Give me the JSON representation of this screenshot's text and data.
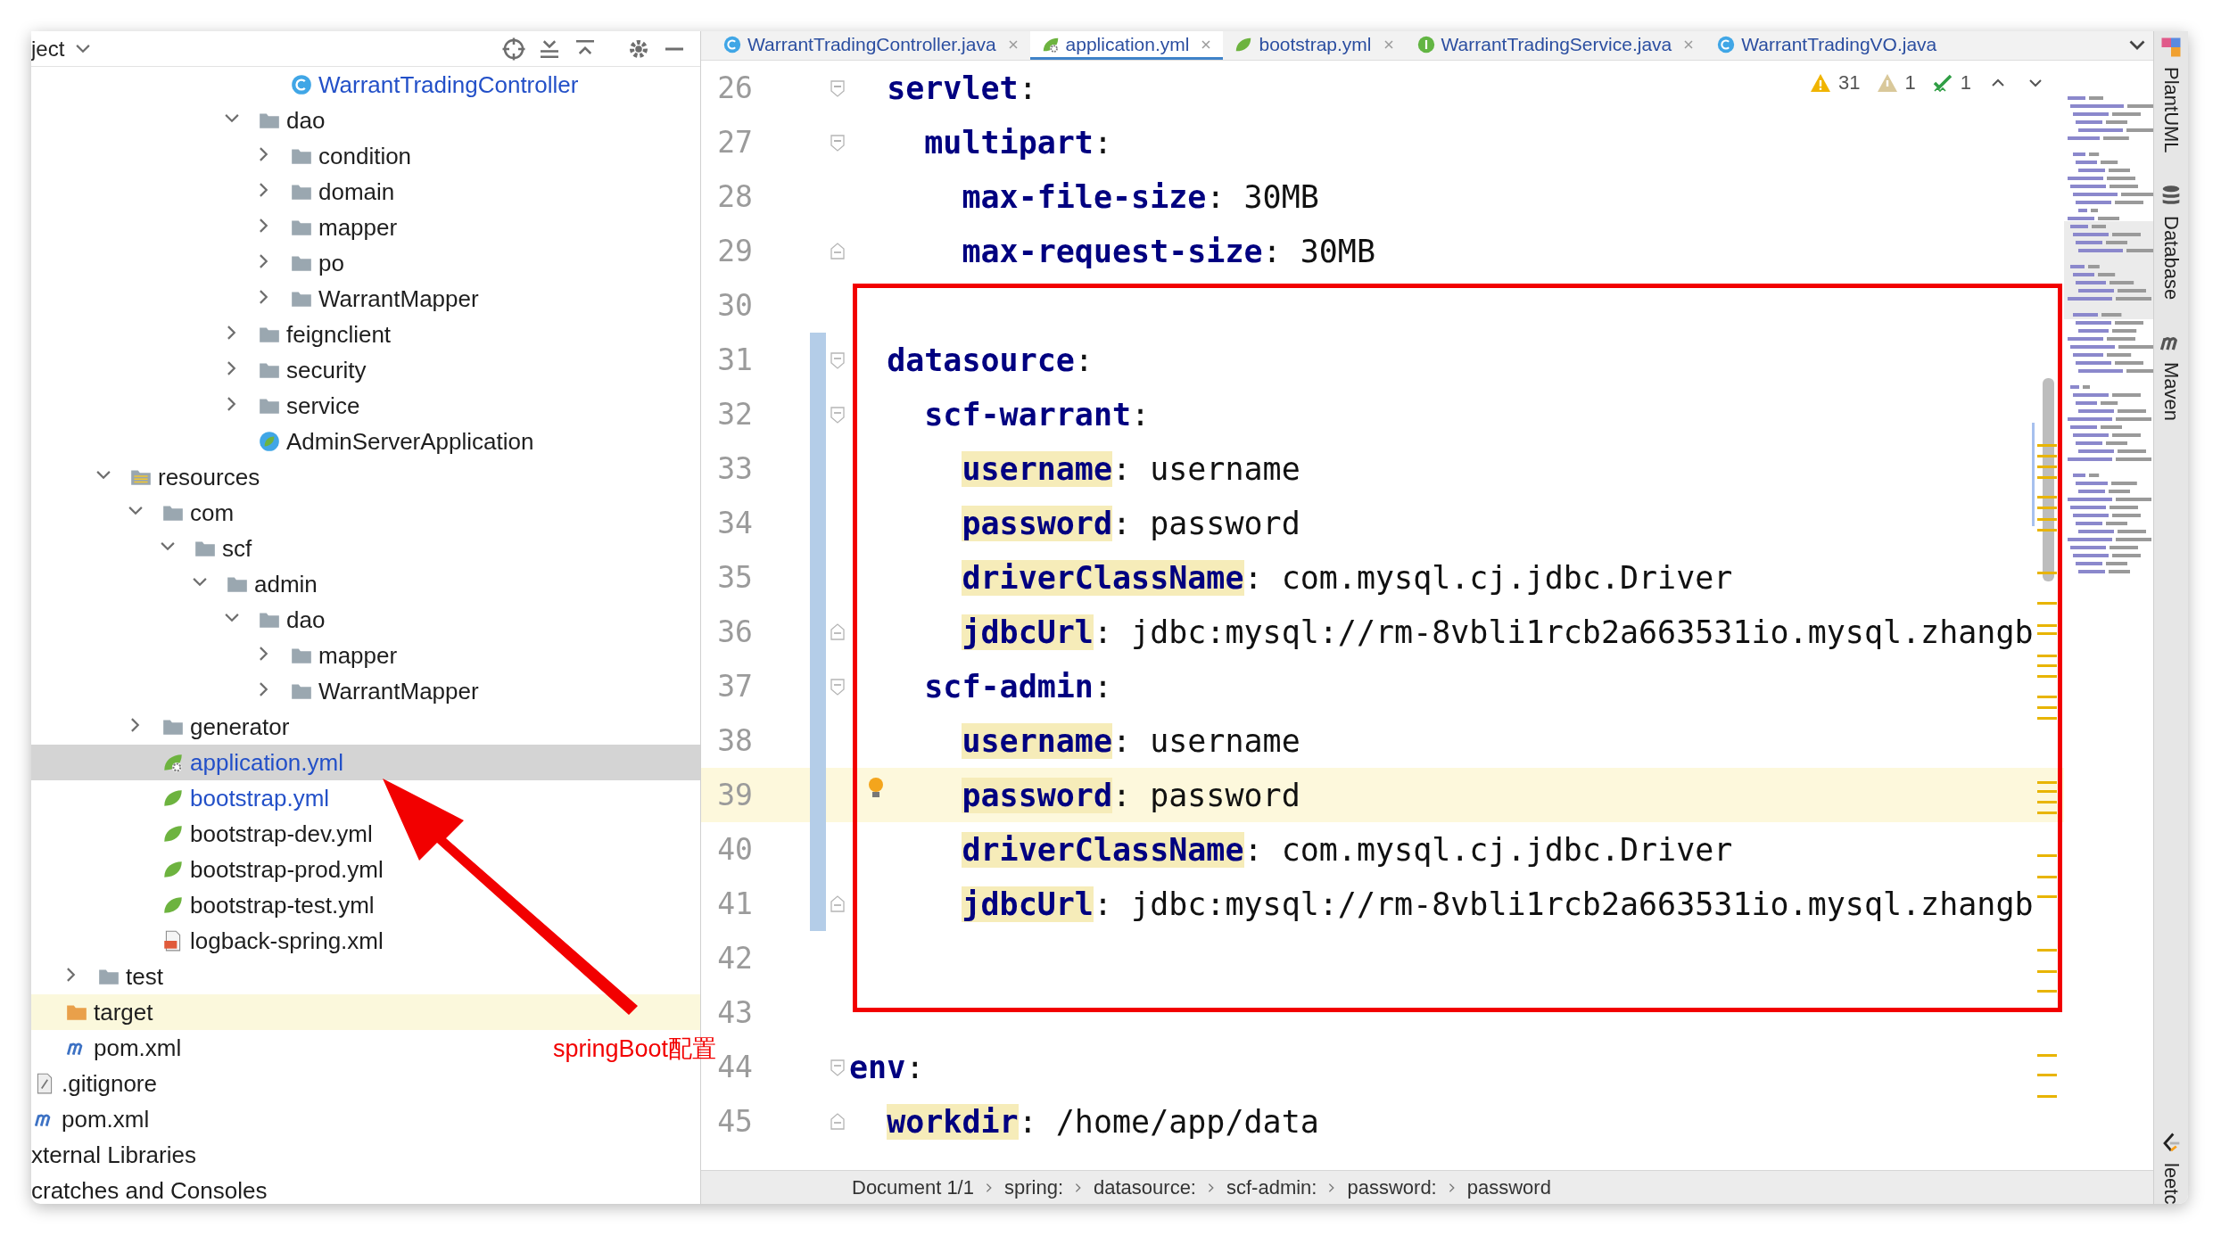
{
  "project_panel": {
    "title": "ject"
  },
  "tree": [
    {
      "children": [
        {
          "children": [
            {
              "children": [
                {
                  "children": [
                    {
                      "children": [
                        {
                          "children": [
                            {
                              "children": [
                                {
                                  "children": [
                                    {
                                      "children": [
                                        {
                                          "label": "WarrantTradingController",
                                          "kind": "class",
                                          "selected": false,
                                          "color": "#2350c8"
                                        }
                                      ]
                                    },
                                    {
                                      "label": "dao",
                                      "kind": "package",
                                      "expanded": true,
                                      "selected": false,
                                      "children": [
                                        {
                                          "label": "condition",
                                          "kind": "package",
                                          "expanded": false,
                                          "selected": false
                                        },
                                        {
                                          "label": "domain",
                                          "kind": "package",
                                          "expanded": false,
                                          "selected": false
                                        },
                                        {
                                          "label": "mapper",
                                          "kind": "package",
                                          "expanded": false,
                                          "selected": false
                                        },
                                        {
                                          "label": "po",
                                          "kind": "package",
                                          "expanded": false,
                                          "selected": false
                                        },
                                        {
                                          "label": "WarrantMapper",
                                          "kind": "package",
                                          "expanded": false,
                                          "selected": false
                                        }
                                      ]
                                    },
                                    {
                                      "label": "feignclient",
                                      "kind": "package",
                                      "expanded": false,
                                      "selected": false
                                    },
                                    {
                                      "label": "security",
                                      "kind": "package",
                                      "expanded": false,
                                      "selected": false
                                    },
                                    {
                                      "label": "service",
                                      "kind": "package",
                                      "expanded": false,
                                      "selected": false
                                    },
                                    {
                                      "label": "AdminServerApplication",
                                      "kind": "app",
                                      "selected": false
                                    }
                                  ]
                                }
                              ]
                            }
                          ]
                        }
                      ]
                    },
                    {
                      "label": "resources",
                      "kind": "resources",
                      "expanded": true,
                      "selected": false,
                      "children": [
                        {
                          "label": "com",
                          "kind": "folder",
                          "expanded": true,
                          "selected": false,
                          "children": [
                            {
                              "label": "scf",
                              "kind": "folder",
                              "expanded": true,
                              "selected": false,
                              "children": [
                                {
                                  "label": "admin",
                                  "kind": "folder",
                                  "expanded": true,
                                  "selected": false,
                                  "children": [
                                    {
                                      "label": "dao",
                                      "kind": "folder",
                                      "expanded": true,
                                      "selected": false,
                                      "children": [
                                        {
                                          "label": "mapper",
                                          "kind": "folder",
                                          "expanded": false,
                                          "selected": false
                                        },
                                        {
                                          "label": "WarrantMapper",
                                          "kind": "folder",
                                          "expanded": false,
                                          "selected": false
                                        }
                                      ]
                                    }
                                  ]
                                }
                              ]
                            }
                          ]
                        },
                        {
                          "label": "generator",
                          "kind": "folder",
                          "expanded": false,
                          "selected": false
                        },
                        {
                          "label": "application.yml",
                          "kind": "config",
                          "selected": true,
                          "color": "#2350c8"
                        },
                        {
                          "label": "bootstrap.yml",
                          "kind": "yml",
                          "selected": false,
                          "color": "#2350c8"
                        },
                        {
                          "label": "bootstrap-dev.yml",
                          "kind": "yml",
                          "selected": false
                        },
                        {
                          "label": "bootstrap-prod.yml",
                          "kind": "yml",
                          "selected": false
                        },
                        {
                          "label": "bootstrap-test.yml",
                          "kind": "yml",
                          "selected": false
                        },
                        {
                          "label": "logback-spring.xml",
                          "kind": "xml",
                          "selected": false
                        }
                      ]
                    }
                  ]
                },
                {
                  "label": "test",
                  "kind": "folder",
                  "expanded": false,
                  "selected": false
                }
              ]
            },
            {
              "label": "target",
              "kind": "excluded",
              "selected": false
            },
            {
              "label": "pom.xml",
              "kind": "maven",
              "selected": false
            }
          ]
        },
        {
          "label": ".gitignore",
          "kind": "ignore",
          "selected": false
        },
        {
          "label": "pom.xml",
          "kind": "maven",
          "selected": false
        }
      ]
    },
    {
      "label": "xternal Libraries",
      "selected": false
    },
    {
      "label": "cratches and Consoles",
      "selected": false
    }
  ],
  "tabs": [
    {
      "label": "WarrantTradingController.java",
      "kind": "class",
      "selected": false,
      "closable": true
    },
    {
      "label": "application.yml",
      "kind": "config",
      "selected": true,
      "closable": true
    },
    {
      "label": "bootstrap.yml",
      "kind": "yml",
      "selected": false,
      "closable": true
    },
    {
      "label": "WarrantTradingService.java",
      "kind": "interface",
      "selected": false,
      "closable": true
    },
    {
      "label": "WarrantTradingVO.java",
      "kind": "class",
      "selected": false,
      "closable": false
    }
  ],
  "inspections": {
    "warnings": "31",
    "weak_warnings": "1",
    "typos": "1"
  },
  "lines": [
    {
      "children": [
        {
          "number": "26",
          "key": "servlet",
          "rest": ":",
          "fold_start": true,
          "changed": false,
          "current": false,
          "flagged": false,
          "children": [
            {
              "number": "27",
              "key": "multipart",
              "rest": ":",
              "fold_start": true,
              "changed": false,
              "current": false,
              "flagged": false,
              "children": [
                {
                  "number": "28",
                  "key": "max-file-size",
                  "rest": ": 30MB",
                  "changed": false,
                  "current": false,
                  "flagged": false
                },
                {
                  "number": "29",
                  "key": "max-request-size",
                  "rest": ": 30MB",
                  "fold_end": true,
                  "changed": false,
                  "current": false,
                  "flagged": false
                }
              ]
            }
          ]
        },
        {
          "number": "30",
          "changed": false,
          "current": false
        },
        {
          "number": "31",
          "key": "datasource",
          "rest": ":",
          "fold_start": true,
          "changed": true,
          "current": false,
          "flagged": false,
          "children": [
            {
              "number": "32",
              "key": "scf-warrant",
              "rest": ":",
              "fold_start": true,
              "changed": true,
              "current": false,
              "flagged": false,
              "children": [
                {
                  "number": "33",
                  "key": "username",
                  "rest": ": username",
                  "changed": true,
                  "current": false,
                  "flagged": true
                },
                {
                  "number": "34",
                  "key": "password",
                  "rest": ": password",
                  "changed": true,
                  "current": false,
                  "flagged": true
                },
                {
                  "number": "35",
                  "key": "driverClassName",
                  "rest": ": com.mysql.cj.jdbc.Driver",
                  "changed": true,
                  "current": false,
                  "flagged": true
                },
                {
                  "number": "36",
                  "key": "jdbcUrl",
                  "rest": ": jdbc:mysql://rm-8vbli1rcb2a663531io.mysql.zhangb",
                  "fold_end": true,
                  "changed": true,
                  "current": false,
                  "flagged": true
                }
              ]
            },
            {
              "number": "37",
              "key": "scf-admin",
              "rest": ":",
              "fold_start": true,
              "changed": true,
              "current": false,
              "flagged": false,
              "children": [
                {
                  "number": "38",
                  "key": "username",
                  "rest": ": username",
                  "changed": true,
                  "current": false,
                  "flagged": true
                },
                {
                  "number": "39",
                  "key": "password",
                  "rest": ": password",
                  "changed": true,
                  "current": true,
                  "flagged": true
                },
                {
                  "number": "40",
                  "key": "driverClassName",
                  "rest": ": com.mysql.cj.jdbc.Driver",
                  "changed": true,
                  "current": false,
                  "flagged": true
                },
                {
                  "number": "41",
                  "key": "jdbcUrl",
                  "rest": ": jdbc:mysql://rm-8vbli1rcb2a663531io.mysql.zhangb",
                  "fold_end": true,
                  "changed": true,
                  "current": false,
                  "flagged": true
                }
              ]
            }
          ]
        },
        {
          "number": "42",
          "changed": false,
          "current": false
        },
        {
          "number": "43",
          "changed": false,
          "current": false
        }
      ]
    },
    {
      "number": "44",
      "key": "env",
      "rest": ":",
      "fold_start": true,
      "changed": false,
      "current": false,
      "flagged": false,
      "children": [
        {
          "number": "45",
          "key": "workdir",
          "rest": ": /home/app/data",
          "fold_end": true,
          "changed": false,
          "current": false,
          "flagged": true
        }
      ]
    }
  ],
  "annotation": {
    "label": "springBoot配置"
  },
  "status_bar": {
    "document": "Document 1/1",
    "breadcrumbs": [
      "spring:",
      "datasource:",
      "scf-admin:",
      "password:",
      "password"
    ]
  },
  "tool_windows": [
    {
      "label": "PlantUML",
      "kind": "plantuml"
    },
    {
      "label": "Database",
      "kind": "database"
    },
    {
      "label": "Maven",
      "kind": "maven"
    },
    {
      "label": "leetc",
      "kind": "leetcode"
    }
  ]
}
